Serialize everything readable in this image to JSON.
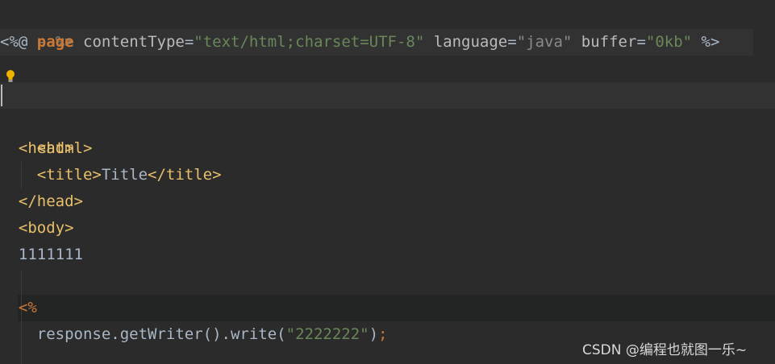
{
  "editor": {
    "line_comment_end": "--%>",
    "directive": {
      "open": "<%@",
      "keyword": "page",
      "attr1_name": "contentType",
      "attr1_value": "\"text/html;charset=UTF-8\"",
      "attr2_name": "language",
      "attr2_value": "\"java\"",
      "attr3_name": "buffer",
      "attr3_value": "\"0kb\"",
      "close": "%>"
    },
    "html_open": "<html>",
    "head_open": "<head>",
    "title_open": "<title>",
    "title_text": "Title",
    "title_close": "</title>",
    "head_close": "</head>",
    "body_open": "<body>",
    "body_text": "1111111",
    "scriptlet_open": "<%",
    "code": {
      "call": "response.getWriter().write(",
      "arg": "\"2222222\"",
      "end": ")",
      "semicolon": ";"
    }
  },
  "watermark": "CSDN @编程也就图一乐~",
  "colors": {
    "background": "#2b2b2b",
    "tag": "#e8bf6a",
    "keyword": "#cc7832",
    "string": "#6a8759",
    "comment": "#808080",
    "text": "#a9b7c6"
  },
  "icons": [
    "lightbulb-icon"
  ]
}
